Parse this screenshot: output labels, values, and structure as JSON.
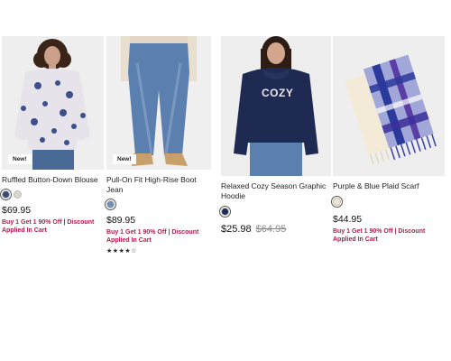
{
  "products": [
    {
      "name": "Ruffled Button-Down Blouse",
      "badge": "New!",
      "price": "$69.95",
      "promo": "Buy 1 Get 1 90% Off | Discount Applied In Cart",
      "swatches": [
        "#3b4a7a",
        "#d9d6cc"
      ],
      "icon": "blouse-photo"
    },
    {
      "name": "Pull-On Fit High-Rise Boot Jean",
      "badge": "New!",
      "price": "$89.95",
      "promo": "Buy 1 Get 1 90% Off | Discount Applied In Cart",
      "swatches": [
        "#6f8fb8"
      ],
      "rating": 3.5,
      "rating_max": 5,
      "icon": "jeans-photo"
    },
    {
      "name": "Relaxed Cozy Season Graphic Hoodie",
      "graphic_text": "COZY",
      "price": "$25.98",
      "was_price": "$64.95",
      "swatches": [
        "#1f2a52"
      ],
      "icon": "hoodie-photo"
    },
    {
      "name": "Purple & Blue Plaid Scarf",
      "price": "$44.95",
      "promo": "Buy 1 Get 1 90% Off | Discount Applied In Cart",
      "swatches": [
        "#f1e6cf"
      ],
      "icon": "scarf-photo"
    }
  ],
  "colors": {
    "promo": "#b21c4b",
    "strike": "#8a8a8a"
  }
}
